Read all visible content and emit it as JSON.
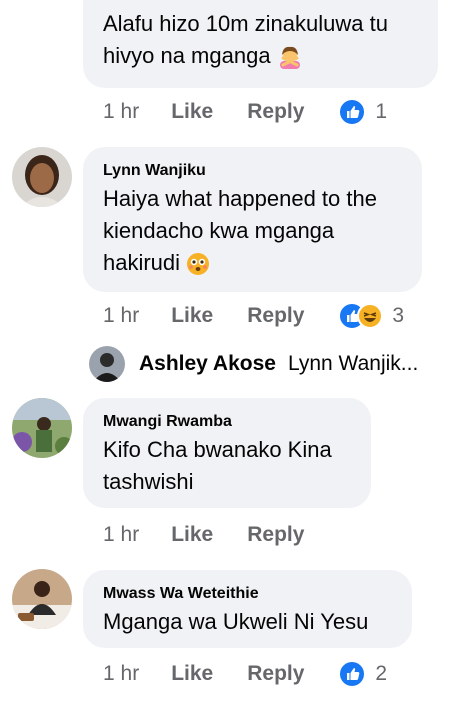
{
  "comments": [
    {
      "text_lines": [
        "Alafu hizo 10m zinakuluwa tu",
        "hivyo na mganga"
      ],
      "time": "1 hr",
      "like": "Like",
      "reply": "Reply",
      "reaction_count": "1"
    },
    {
      "author": "Lynn Wanjiku",
      "text_lines": [
        "Haiya what happened to the",
        "kiendacho kwa mganga",
        "hakirudi"
      ],
      "time": "1 hr",
      "like": "Like",
      "reply": "Reply",
      "reaction_count": "3"
    },
    {
      "author": "Mwangi Rwamba",
      "text_lines": [
        "Kifo Cha bwanako Kina",
        "tashwishi"
      ],
      "time": "1 hr",
      "like": "Like",
      "reply": "Reply"
    },
    {
      "author": "Mwass Wa Weteithie",
      "text_lines": [
        "Mganga wa Ukweli Ni Yesu"
      ],
      "time": "1 hr",
      "like": "Like",
      "reply": "Reply",
      "reaction_count": "2"
    }
  ],
  "reply_preview": {
    "author": "Ashley Akose",
    "snippet": "Lynn Wanjik..."
  },
  "icons": {
    "like_reaction": "like-reaction-icon",
    "haha_reaction": "haha-reaction-icon",
    "emoji_shrug": "woman-gesturing-no-emoji",
    "emoji_flushed": "flushed-face-emoji"
  },
  "colors": {
    "like_blue": "#1877f2",
    "meta_gray": "#65676b",
    "bubble": "#f0f2f5"
  }
}
